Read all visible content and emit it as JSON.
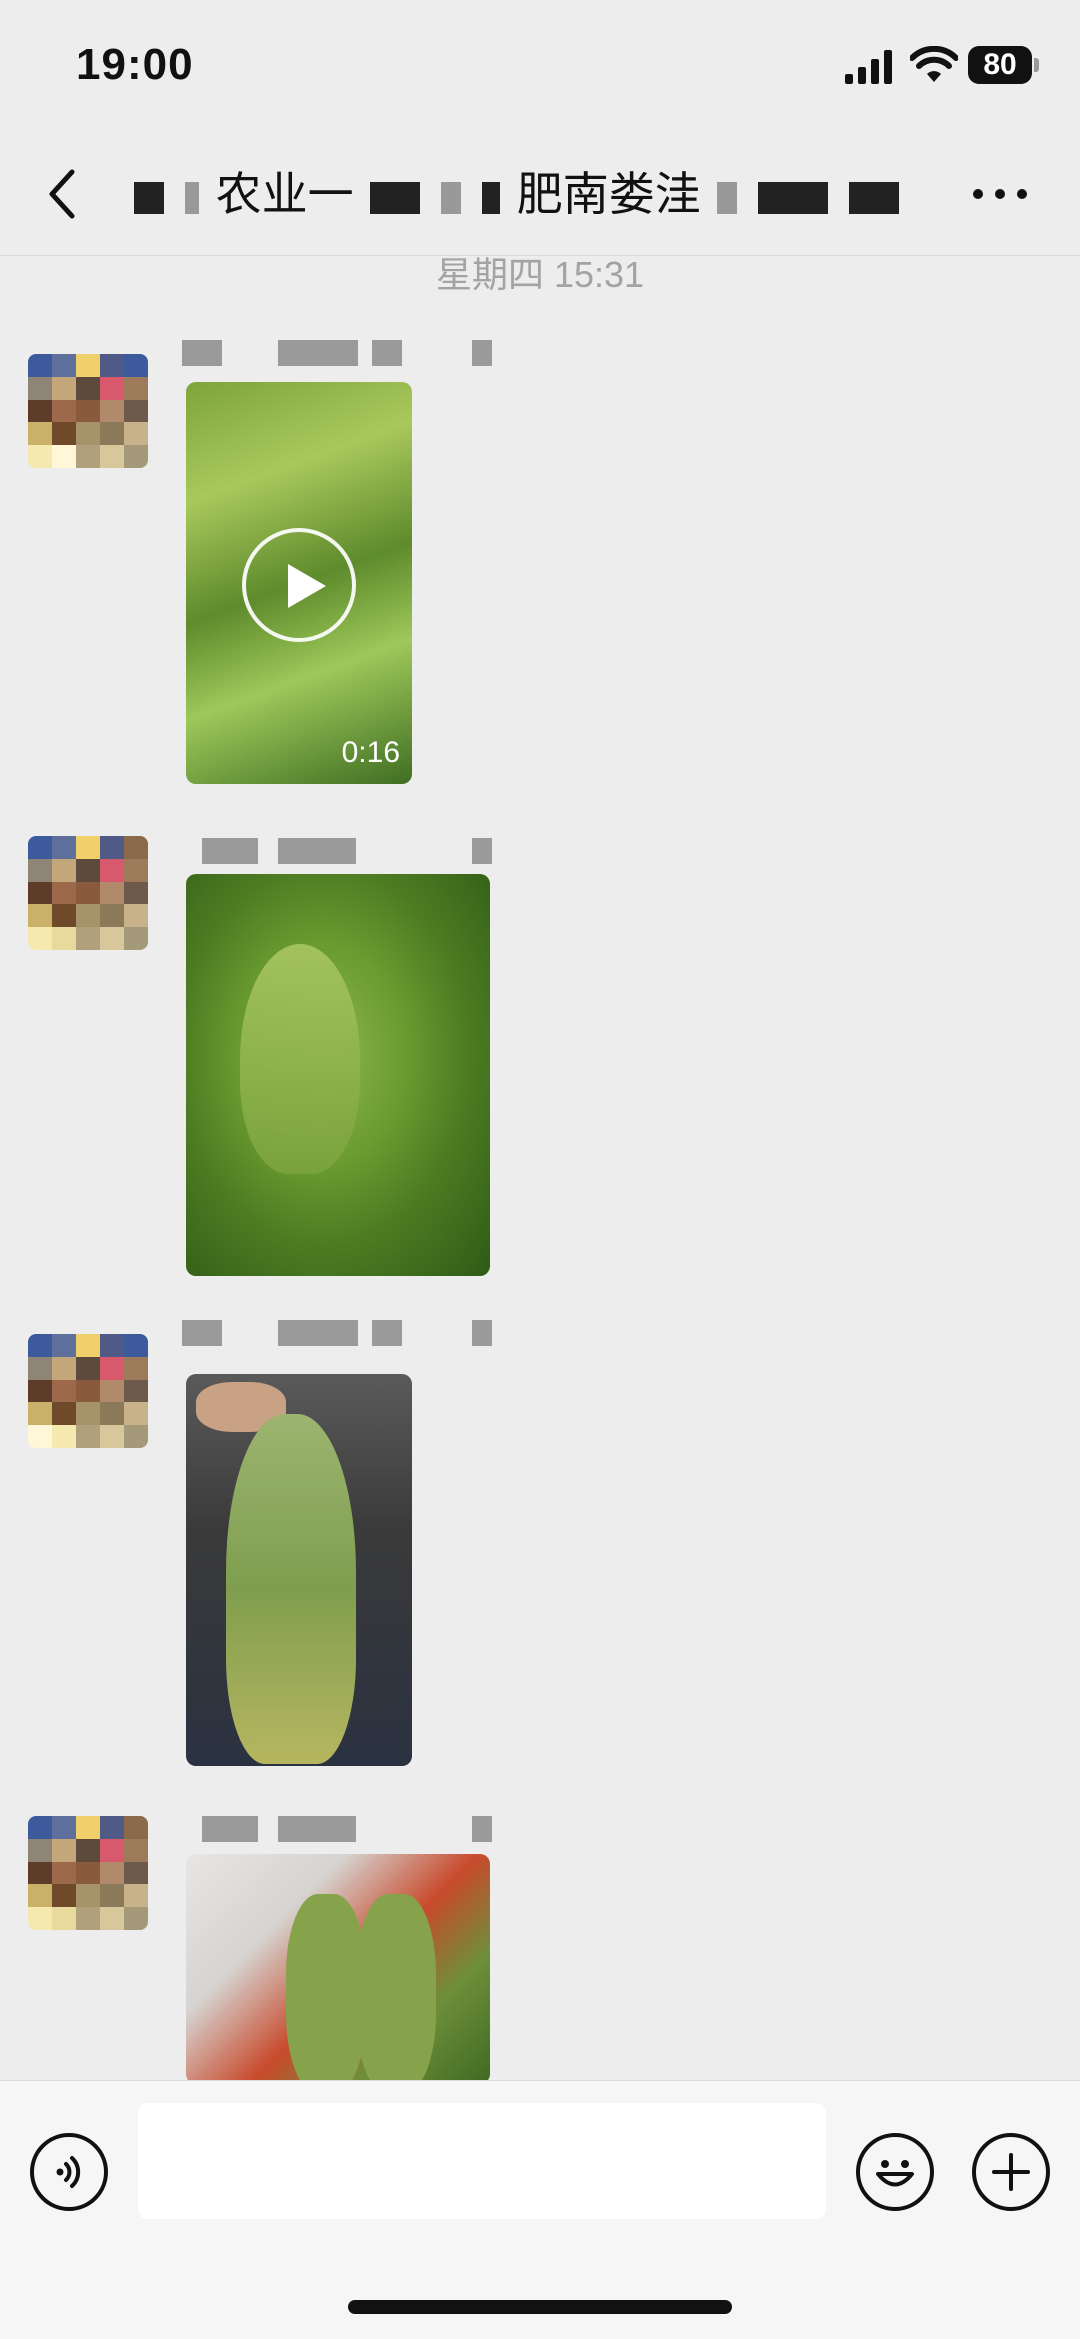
{
  "status_bar": {
    "time": "19:00",
    "battery": "80"
  },
  "nav": {
    "title_parts": [
      "农业一",
      "肥南娄洼"
    ],
    "back_icon": "chevron-left-icon",
    "more_icon": "more-dots-icon"
  },
  "date_separator": "星期四 15:31",
  "messages": [
    {
      "type": "video",
      "duration": "0:16"
    },
    {
      "type": "image"
    },
    {
      "type": "image"
    },
    {
      "type": "image"
    }
  ],
  "input_bar": {
    "voice_icon": "voice-icon",
    "emoji_icon": "emoji-icon",
    "plus_icon": "plus-icon"
  },
  "colors": {
    "background": "#ededed",
    "input_bar": "#f6f6f6",
    "timestamp": "#a3a3a3"
  }
}
